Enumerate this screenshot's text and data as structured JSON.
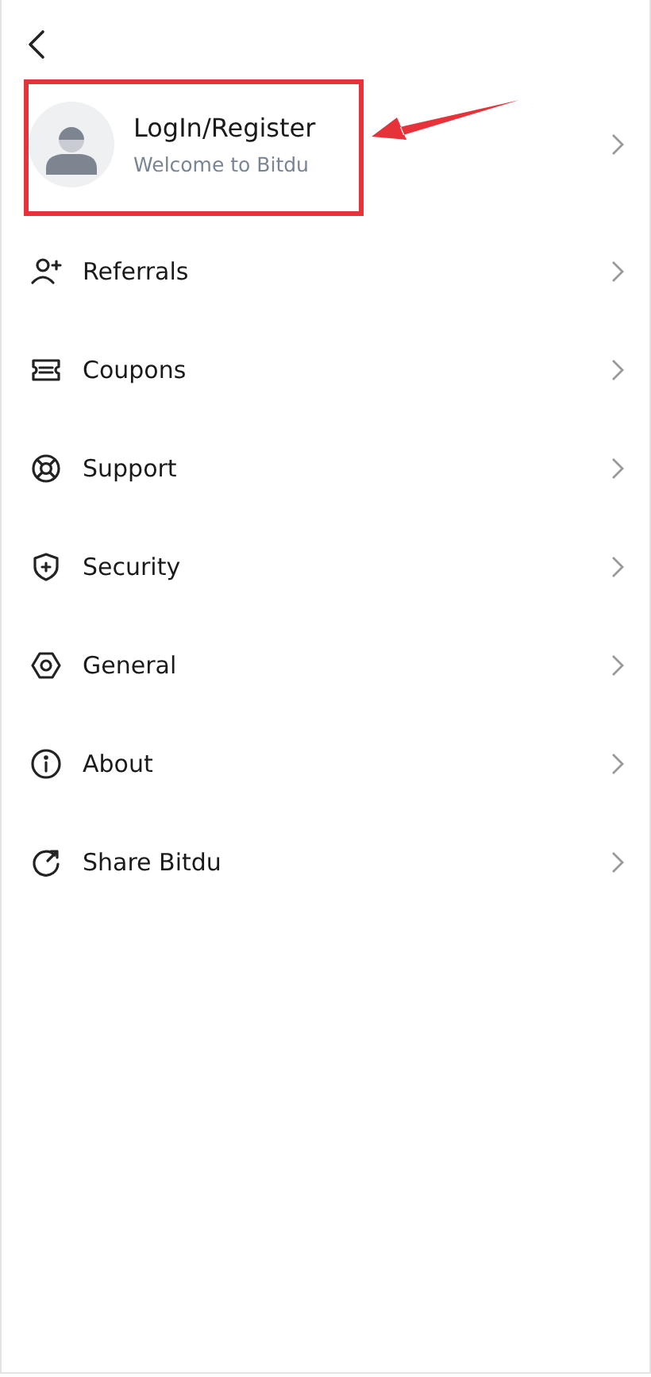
{
  "profile": {
    "title": "LogIn/Register",
    "subtitle": "Welcome to Bitdu"
  },
  "menu": [
    {
      "label": "Referrals"
    },
    {
      "label": "Coupons"
    },
    {
      "label": "Support"
    },
    {
      "label": "Security"
    },
    {
      "label": "General"
    },
    {
      "label": "About"
    },
    {
      "label": "Share Bitdu"
    }
  ]
}
